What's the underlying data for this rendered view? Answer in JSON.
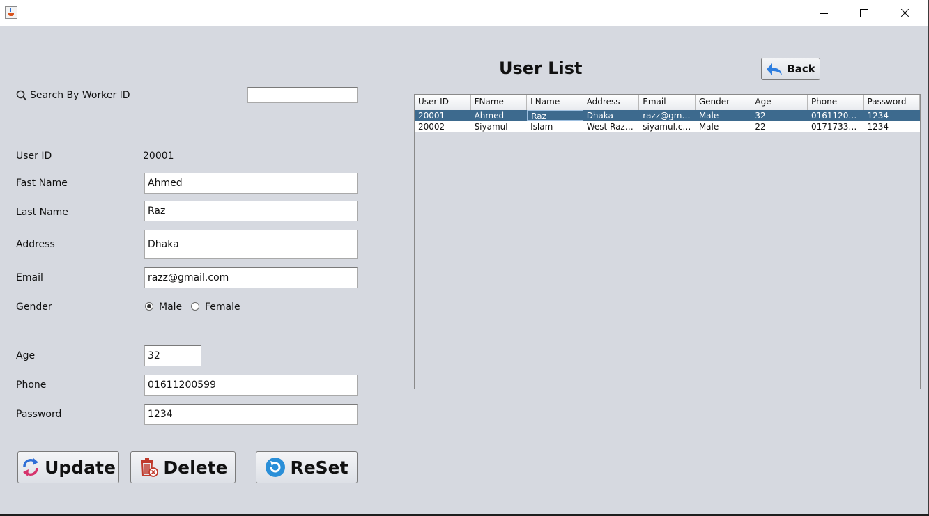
{
  "window": {
    "title": ""
  },
  "search": {
    "label": "Search By Worker ID",
    "value": ""
  },
  "form": {
    "user_id": {
      "label": "User ID",
      "value": "20001"
    },
    "first_name": {
      "label": "Fast Name",
      "value": "Ahmed"
    },
    "last_name": {
      "label": "Last Name",
      "value": "Raz"
    },
    "address": {
      "label": "Address",
      "value": "Dhaka"
    },
    "email": {
      "label": "Email",
      "value": "razz@gmail.com"
    },
    "gender": {
      "label": "Gender",
      "options": [
        "Male",
        "Female"
      ],
      "selected": "Male"
    },
    "age": {
      "label": "Age",
      "value": "32"
    },
    "phone": {
      "label": "Phone",
      "value": "01611200599"
    },
    "password": {
      "label": "Password",
      "value": "1234"
    }
  },
  "buttons": {
    "update": "Update",
    "delete": "Delete",
    "reset": "ReSet",
    "back": "Back"
  },
  "list": {
    "title": "User List",
    "columns": [
      "User ID",
      "FName",
      "LName",
      "Address",
      "Email",
      "Gender",
      "Age",
      "Phone",
      "Password"
    ],
    "rows": [
      [
        "20001",
        "Ahmed",
        "Raz",
        "Dhaka",
        "razz@gmai...",
        "Male",
        "32",
        "01611200...",
        "1234"
      ],
      [
        "20002",
        "Siyamul",
        "Islam",
        "West Raza...",
        "siyamul.cs...",
        "Male",
        "22",
        "01717338...",
        "1234"
      ]
    ],
    "selected_row": 0
  },
  "colors": {
    "background": "#d6d9e0",
    "selection": "#3d6a8e",
    "update_icon": "#2f6fd6",
    "delete_icon": "#c0392b",
    "reset_icon": "#2a8fd8"
  }
}
